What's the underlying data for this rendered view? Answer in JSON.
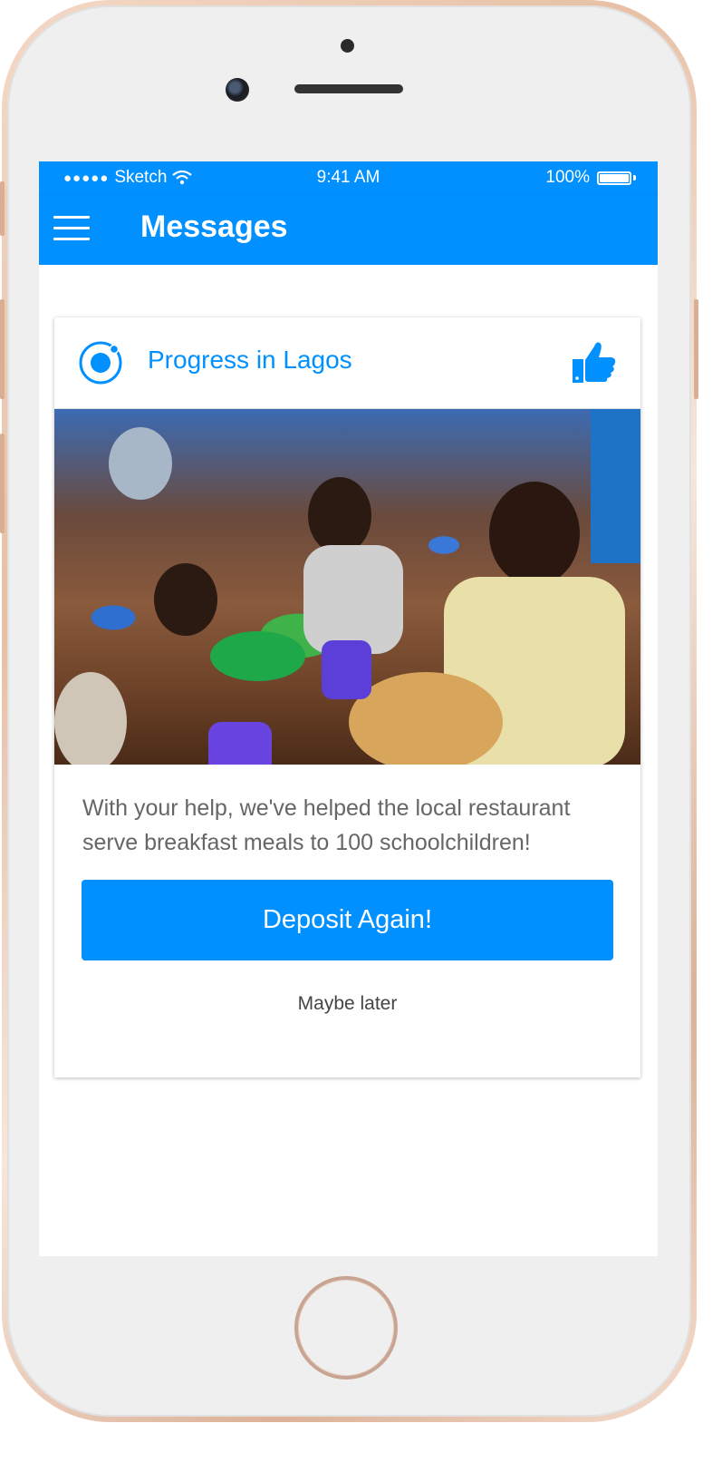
{
  "status_bar": {
    "carrier": "Sketch",
    "time": "9:41 AM",
    "battery": "100%"
  },
  "nav": {
    "title": "Messages"
  },
  "card": {
    "title": "Progress in Lagos",
    "message": "With your help, we've helped the local restaurant serve breakfast meals to 100 schoolchildren!",
    "primary_button": "Deposit Again!",
    "secondary_button": "Maybe later"
  },
  "colors": {
    "accent": "#0090ff",
    "text_muted": "#666666",
    "phone_frame": "#e7c0a5"
  },
  "icons": {
    "menu": "menu-icon",
    "brand": "ionic-logo-icon",
    "like": "thumbs-up-icon",
    "wifi": "wifi-icon",
    "battery": "battery-icon"
  }
}
